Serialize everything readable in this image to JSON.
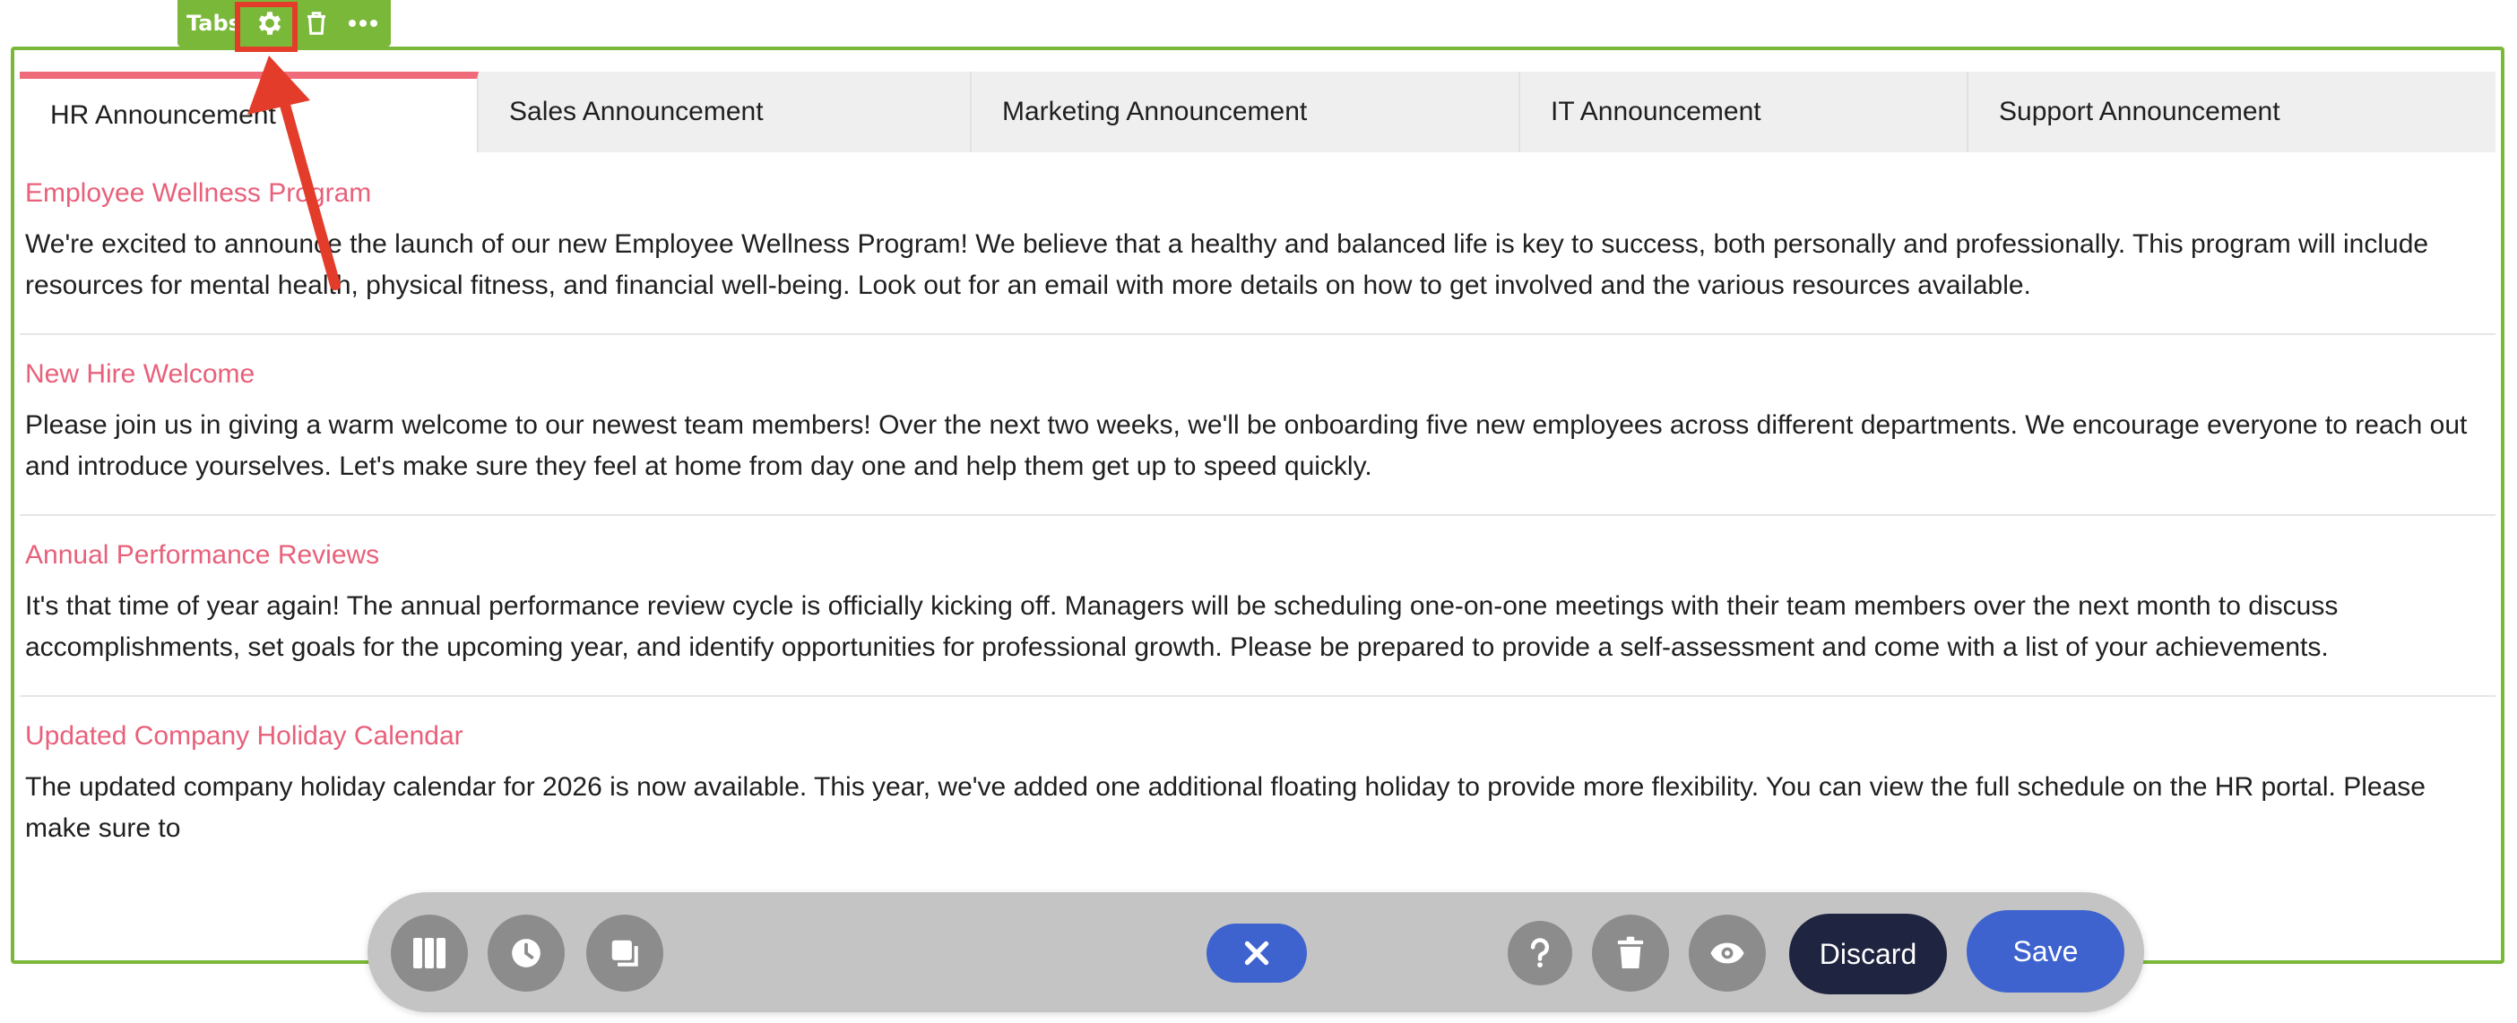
{
  "block_toolbar": {
    "label": "Tabs",
    "icons": [
      "gear-icon",
      "trash-icon",
      "more-icon"
    ]
  },
  "tabs": [
    {
      "label": "HR Announcement",
      "active": true
    },
    {
      "label": "Sales Announcement",
      "active": false
    },
    {
      "label": "Marketing Announcement",
      "active": false
    },
    {
      "label": "IT Announcement",
      "active": false
    },
    {
      "label": "Support Announcement",
      "active": false
    }
  ],
  "items": [
    {
      "title": "Employee Wellness Program",
      "body": "We're excited to announce the launch of our new Employee Wellness Program! We believe that a healthy and balanced life is key to success, both personally and professionally. This program will include resources for mental health, physical fitness, and financial well-being. Look out for an email with more details on how to get involved and the various resources available."
    },
    {
      "title": "New Hire Welcome",
      "body": "Please join us in giving a warm welcome to our newest team members! Over the next two weeks, we'll be onboarding five new employees across different departments. We encourage everyone to reach out and introduce yourselves. Let's make sure they feel at home from day one and help them get up to speed quickly."
    },
    {
      "title": "Annual Performance Reviews",
      "body": "It's that time of year again! The annual performance review cycle is officially kicking off. Managers will be scheduling one-on-one meetings with their team members over the next month to discuss accomplishments, set goals for the upcoming year, and identify opportunities for professional growth. Please be prepared to provide a self-assessment and come with a list of your achievements."
    },
    {
      "title": "Updated Company Holiday Calendar",
      "body": "The updated company holiday calendar for 2026 is now available. This year, we've added one additional floating holiday to provide more flexibility. You can view the full schedule on the HR portal. Please make sure to"
    }
  ],
  "editor_bar": {
    "left_icons": [
      "columns-icon",
      "history-icon",
      "layers-icon"
    ],
    "center_icon": "close-icon",
    "right_icons": [
      "help-icon",
      "delete-icon",
      "preview-icon"
    ],
    "discard_label": "Discard",
    "save_label": "Save"
  },
  "colors": {
    "block_green": "#7ab83a",
    "accent_pink": "#e8607a",
    "tab_active_bar": "#ef6b7a",
    "annotation_red": "#e33c2a",
    "primary_blue": "#3e63cf",
    "discard_dark": "#1f2440"
  }
}
